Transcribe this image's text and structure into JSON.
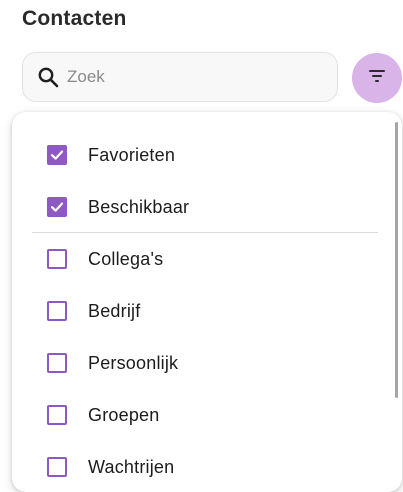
{
  "header": {
    "title": "Contacten"
  },
  "search": {
    "placeholder": "Zoek",
    "value": "",
    "icon": "search-icon"
  },
  "filter_button": {
    "icon": "filter-list-icon",
    "color": "#d8b4e8"
  },
  "filter_menu": {
    "accent_color": "#8e59c2",
    "groups": [
      [
        {
          "label": "Favorieten",
          "checked": true
        },
        {
          "label": "Beschikbaar",
          "checked": true
        }
      ],
      [
        {
          "label": "Collega's",
          "checked": false
        },
        {
          "label": "Bedrijf",
          "checked": false
        },
        {
          "label": "Persoonlijk",
          "checked": false
        },
        {
          "label": "Groepen",
          "checked": false
        },
        {
          "label": "Wachtrijen",
          "checked": false
        }
      ]
    ]
  }
}
